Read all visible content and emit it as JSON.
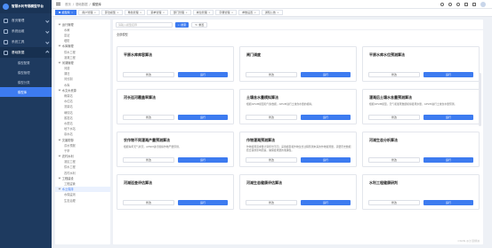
{
  "app": {
    "title": "智慧水利专题模型平台"
  },
  "sidebar": {
    "items": [
      {
        "label": "首页管理",
        "icon": "home-icon"
      },
      {
        "label": "系统运维",
        "icon": "monitor-icon"
      },
      {
        "label": "系统工具",
        "icon": "tool-icon"
      },
      {
        "label": "基础数据",
        "icon": "database-icon"
      }
    ],
    "subitems": [
      {
        "label": "模型配置"
      },
      {
        "label": "模型管理"
      },
      {
        "label": "模型分类"
      },
      {
        "label": "模型库"
      }
    ]
  },
  "topbar": {
    "breadcrumb": [
      "首页",
      "基础数据",
      "模型库"
    ]
  },
  "tabs": [
    {
      "label": "模型库"
    },
    {
      "label": "用户管理"
    },
    {
      "label": "算法模型"
    },
    {
      "label": "角色管理"
    },
    {
      "label": "菜单管理"
    },
    {
      "label": "部门管理"
    },
    {
      "label": "岗位管理"
    },
    {
      "label": "字典管理"
    },
    {
      "label": "参数设置"
    },
    {
      "label": "通知公告"
    }
  ],
  "tree": {
    "items": [
      {
        "label": "运行管理",
        "level": 0
      },
      {
        "label": "水闸",
        "level": 1
      },
      {
        "label": "泵站",
        "level": 1
      },
      {
        "label": "堤防",
        "level": 1
      },
      {
        "label": "水库管理",
        "level": 0
      },
      {
        "label": "供水工程",
        "level": 1
      },
      {
        "label": "灌溉工程",
        "level": 1
      },
      {
        "label": "河湖管理",
        "level": 0
      },
      {
        "label": "河道",
        "level": 1
      },
      {
        "label": "湖泊",
        "level": 1
      },
      {
        "label": "河长制",
        "level": 1
      },
      {
        "label": "水库",
        "level": 1
      },
      {
        "label": "水文水资源",
        "level": 0
      },
      {
        "label": "雨量站",
        "level": 1
      },
      {
        "label": "水位站",
        "level": 1
      },
      {
        "label": "流量站",
        "level": 1
      },
      {
        "label": "墒情站",
        "level": 1
      },
      {
        "label": "蒸发站",
        "level": 1
      },
      {
        "label": "水质站",
        "level": 1
      },
      {
        "label": "地下水站",
        "level": 1
      },
      {
        "label": "泉水站",
        "level": 1
      },
      {
        "label": "灾害防御",
        "level": 0
      },
      {
        "label": "洪水预报",
        "level": 1
      },
      {
        "label": "干旱",
        "level": 1
      },
      {
        "label": "农村水利",
        "level": 0
      },
      {
        "label": "灌区工程",
        "level": 1
      },
      {
        "label": "供水工程",
        "level": 1
      },
      {
        "label": "农村水利",
        "level": 1
      },
      {
        "label": "工程建设",
        "level": 0
      },
      {
        "label": "工程监管",
        "level": 1
      },
      {
        "label": "水土保持",
        "level": 0
      },
      {
        "label": "水保监测",
        "level": 1
      },
      {
        "label": "生态治理",
        "level": 1
      }
    ]
  },
  "search": {
    "placeholder": "请输入模型名称",
    "button": "搜索",
    "reset": "重置"
  },
  "group_heading": "全部模型",
  "cards": [
    {
      "title": "平原水库库容算法",
      "desc": ""
    },
    {
      "title": "闸门调度",
      "desc": ""
    },
    {
      "title": "平原水库水位预测算法",
      "desc": ""
    },
    {
      "title": "河长巡河覆盖率算法",
      "desc": ""
    },
    {
      "title": "土壤含水量模拟算法",
      "desc": "根据APSIM模型和气象数据，APSIM进行土壤含水量的模拟。"
    },
    {
      "title": "灌溉后土壤水含量预测算法",
      "desc": "根据APSIM模型，天气和灌溉数据模拟灌溉水量，APSIM进行土壤含水量预测。"
    },
    {
      "title": "农作物不同灌溉产量预测算法",
      "desc": "根据每年天气状况，APSIM进行模拟作物产量预测。"
    },
    {
      "title": "作物灌溉预测算法",
      "desc": "作物灌溉需求量计算年份不同，采用模型和作物生长过程预测未来的作物灌溉量，需要历史数据结合其他影响因素，确保灌溉量的准确性。"
    },
    {
      "title": "河湖生态分析算法",
      "desc": ""
    },
    {
      "title": "河湖巡查评估算法",
      "desc": ""
    },
    {
      "title": "河湖生态健康评估算法",
      "desc": ""
    },
    {
      "title": "水利工程健康研判",
      "desc": ""
    }
  ],
  "card_buttons": {
    "edit": "修改",
    "run": "运行"
  },
  "watermark": "CSDN @沙漠绿洲"
}
